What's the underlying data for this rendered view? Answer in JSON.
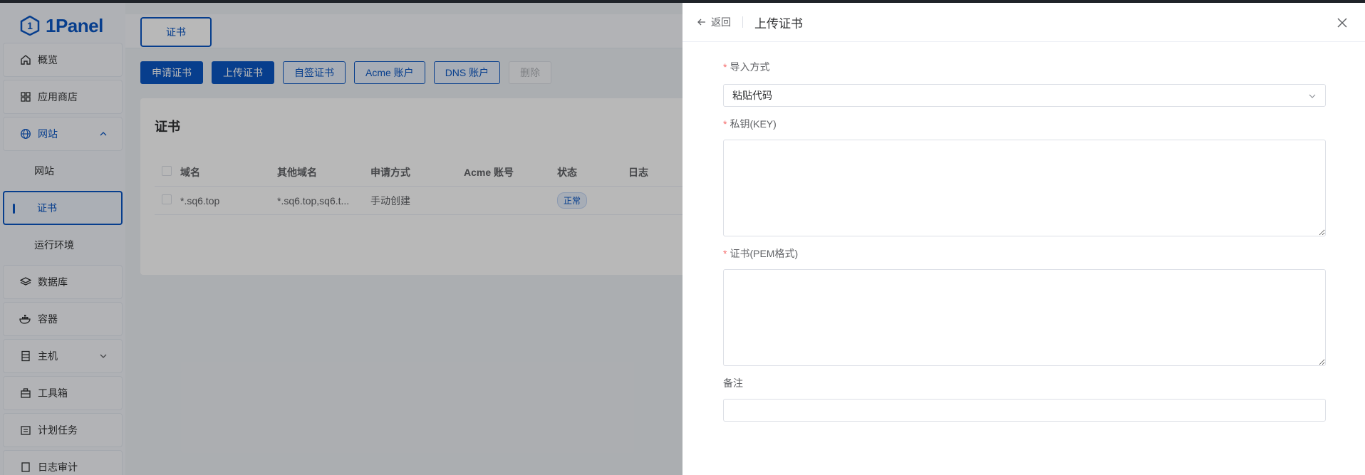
{
  "brand": {
    "name": "1Panel",
    "color": "#0b57c4"
  },
  "sidebar": {
    "items": [
      {
        "label": "概览",
        "icon": "home-icon"
      },
      {
        "label": "应用商店",
        "icon": "grid-icon"
      },
      {
        "label": "网站",
        "icon": "globe-icon",
        "expanded": true,
        "children": [
          {
            "label": "网站"
          },
          {
            "label": "证书",
            "active": true
          },
          {
            "label": "运行环境"
          }
        ]
      },
      {
        "label": "数据库",
        "icon": "layers-icon"
      },
      {
        "label": "容器",
        "icon": "docker-icon"
      },
      {
        "label": "主机",
        "icon": "server-icon",
        "collapsed": true
      },
      {
        "label": "工具箱",
        "icon": "toolbox-icon"
      },
      {
        "label": "计划任务",
        "icon": "calendar-icon"
      },
      {
        "label": "日志审计",
        "icon": "log-icon"
      }
    ]
  },
  "main": {
    "tab": "证书",
    "toolbar": {
      "apply": "申请证书",
      "upload": "上传证书",
      "self_signed": "自签证书",
      "acme_account": "Acme 账户",
      "dns_account": "DNS 账户",
      "delete": "删除"
    },
    "card_title": "证书",
    "table": {
      "headers": {
        "domain": "域名",
        "other": "其他域名",
        "method": "申请方式",
        "acme": "Acme 账号",
        "status": "状态",
        "log": "日志"
      },
      "rows": [
        {
          "domain": "*.sq6.top",
          "other": "*.sq6.top,sq6.t...",
          "method": "手动创建",
          "acme": "",
          "status": "正常"
        }
      ]
    }
  },
  "drawer": {
    "back": "返回",
    "title": "上传证书",
    "fields": {
      "import_label": "导入方式",
      "import_value": "粘贴代码",
      "key_label": "私钥(KEY)",
      "key_value": "",
      "cert_label": "证书(PEM格式)",
      "cert_value": "",
      "remark_label": "备注",
      "remark_value": ""
    }
  }
}
